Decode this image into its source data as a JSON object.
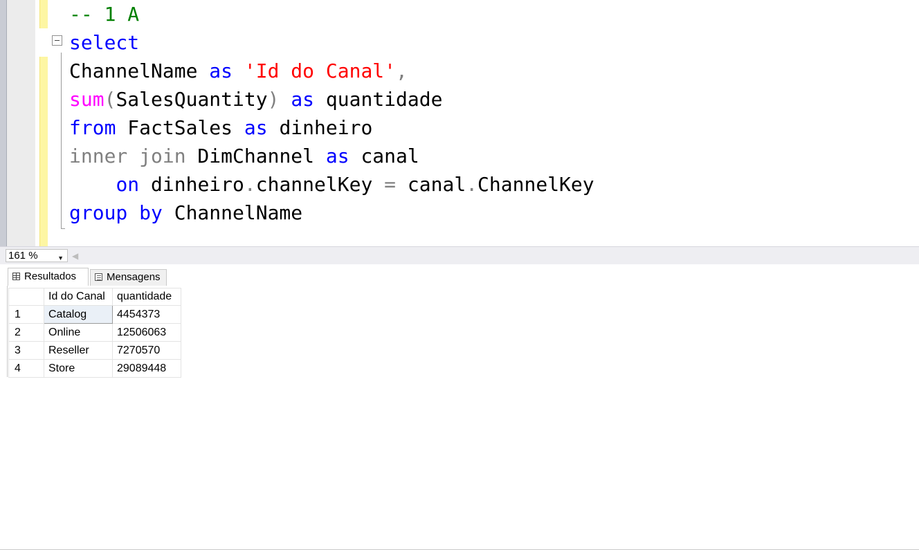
{
  "editor": {
    "lines": [
      [
        {
          "t": "-- 1 A",
          "c": "cm"
        }
      ],
      [
        {
          "t": "select",
          "c": "kw"
        }
      ],
      [
        {
          "t": "ChannelName ",
          "c": ""
        },
        {
          "t": "as",
          "c": "kw"
        },
        {
          "t": " ",
          "c": ""
        },
        {
          "t": "'Id do Canal'",
          "c": "str"
        },
        {
          "t": ",",
          "c": "gr"
        }
      ],
      [
        {
          "t": "sum",
          "c": "fn"
        },
        {
          "t": "(",
          "c": "gr"
        },
        {
          "t": "SalesQuantity",
          "c": ""
        },
        {
          "t": ")",
          "c": "gr"
        },
        {
          "t": " ",
          "c": ""
        },
        {
          "t": "as",
          "c": "kw"
        },
        {
          "t": " quantidade",
          "c": ""
        }
      ],
      [
        {
          "t": "from",
          "c": "kw"
        },
        {
          "t": " FactSales ",
          "c": ""
        },
        {
          "t": "as",
          "c": "kw"
        },
        {
          "t": " dinheiro",
          "c": ""
        }
      ],
      [
        {
          "t": "inner join",
          "c": "gr"
        },
        {
          "t": " DimChannel ",
          "c": ""
        },
        {
          "t": "as",
          "c": "kw"
        },
        {
          "t": " canal",
          "c": ""
        }
      ],
      [
        {
          "t": "    ",
          "c": ""
        },
        {
          "t": "on",
          "c": "kw"
        },
        {
          "t": " dinheiro",
          "c": ""
        },
        {
          "t": ".",
          "c": "gr"
        },
        {
          "t": "channelKey ",
          "c": ""
        },
        {
          "t": "=",
          "c": "gr"
        },
        {
          "t": " canal",
          "c": ""
        },
        {
          "t": ".",
          "c": "gr"
        },
        {
          "t": "ChannelKey",
          "c": ""
        }
      ],
      [
        {
          "t": "group by",
          "c": "kw"
        },
        {
          "t": " ChannelName",
          "c": ""
        }
      ]
    ]
  },
  "zoom": {
    "value": "161 %"
  },
  "tabs": {
    "results_label": "Resultados",
    "messages_label": "Mensagens"
  },
  "results": {
    "columns": [
      "Id do Canal",
      "quantidade"
    ],
    "rows": [
      {
        "num": "1",
        "name": "Catalog",
        "qty": "4454373"
      },
      {
        "num": "2",
        "name": "Online",
        "qty": "12506063"
      },
      {
        "num": "3",
        "name": "Reseller",
        "qty": "7270570"
      },
      {
        "num": "4",
        "name": "Store",
        "qty": "29089448"
      }
    ]
  },
  "colors": {
    "keyword": "#0000ff",
    "function": "#ff00ff",
    "string": "#ff0000",
    "operator": "#808080",
    "comment": "#008000"
  }
}
